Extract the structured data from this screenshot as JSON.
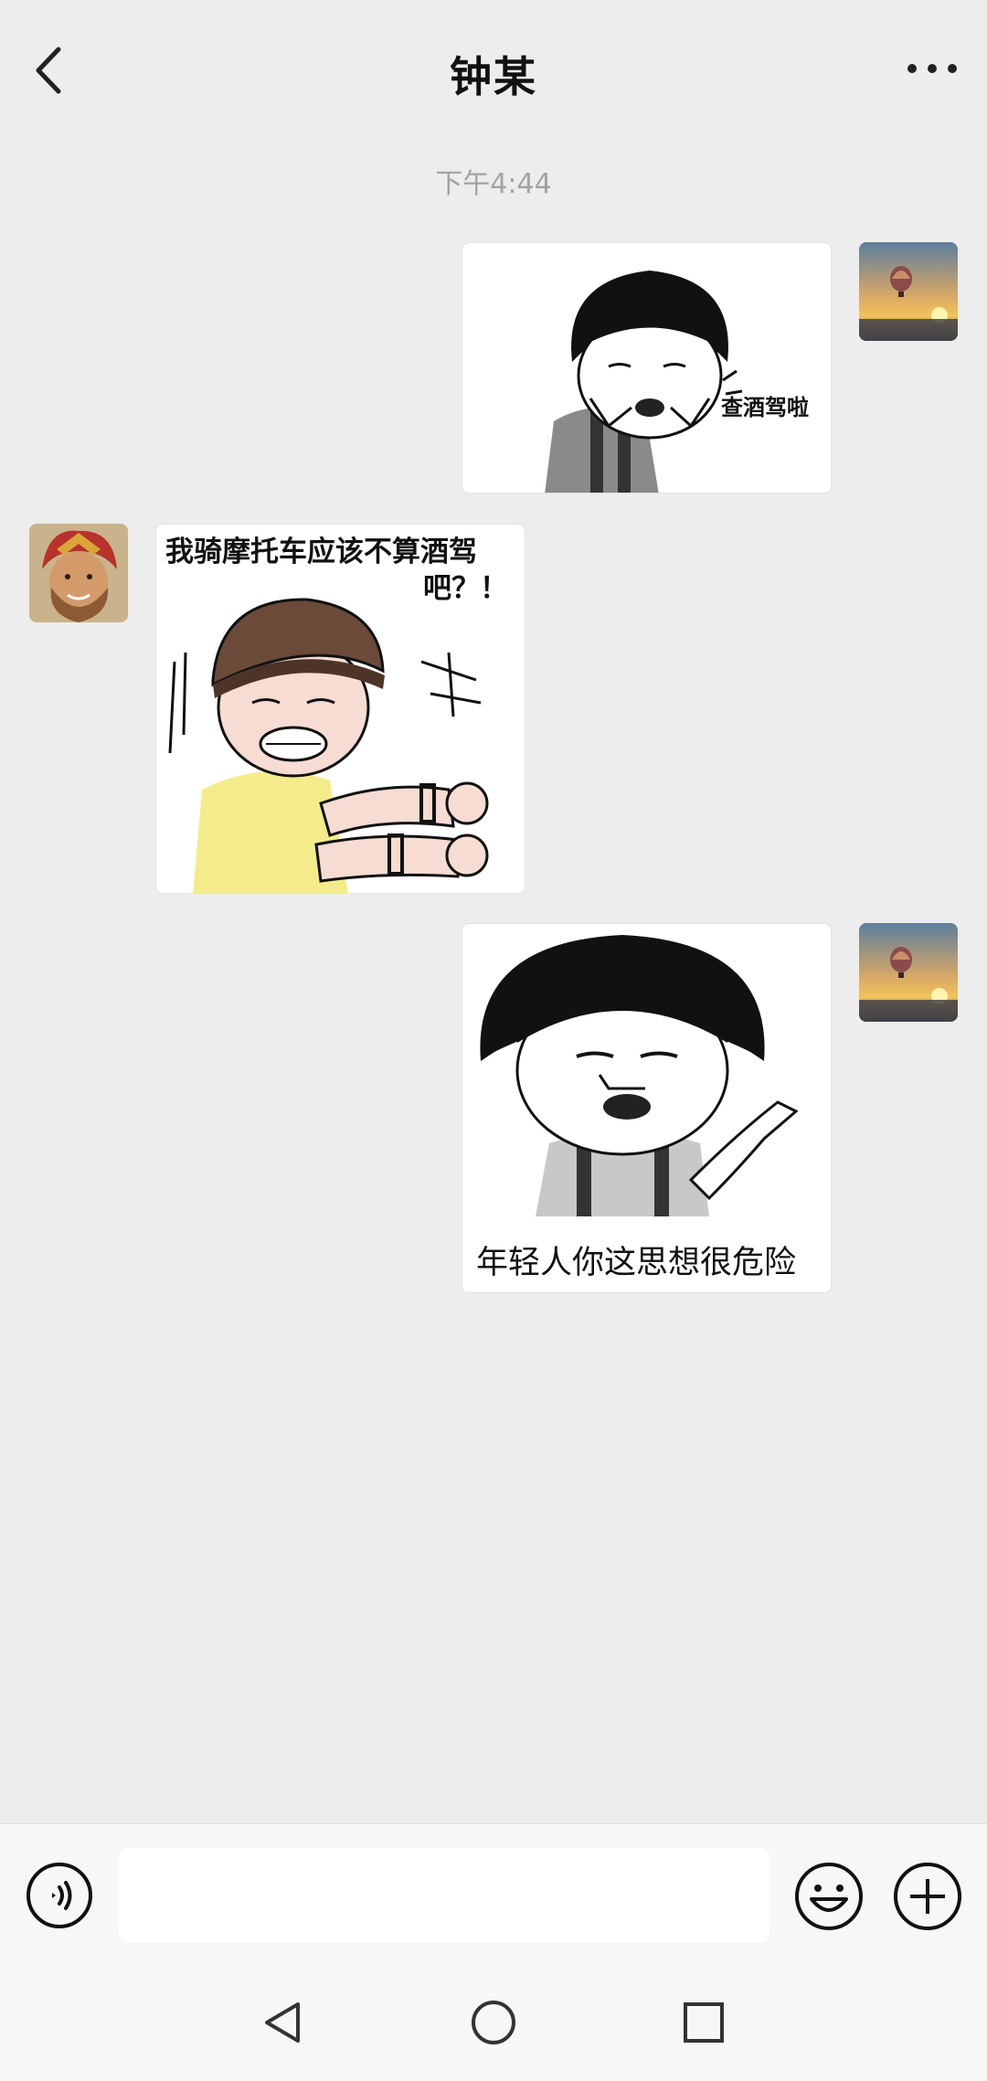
{
  "header": {
    "title": "钟某"
  },
  "chat": {
    "timestamp": "下午4:44",
    "messages": [
      {
        "from": "me",
        "type": "sticker",
        "caption": "查酒驾啦"
      },
      {
        "from": "them",
        "type": "sticker",
        "caption": "我骑摩托车应该不算酒驾",
        "caption_line2": "吧？！"
      },
      {
        "from": "me",
        "type": "sticker",
        "caption": "年轻人你这思想很危险"
      }
    ]
  },
  "input": {
    "value": ""
  },
  "icons": {
    "back": "chevron-left-icon",
    "more": "more-dots-icon",
    "voice": "voice-icon",
    "emoji": "emoji-icon",
    "plus": "plus-icon",
    "nav_back": "triangle-back-icon",
    "nav_home": "circle-home-icon",
    "nav_recent": "square-recent-icon"
  },
  "colors": {
    "background": "#ededed",
    "bar": "#f7f7f7",
    "timestamp": "#a3a3a3"
  }
}
